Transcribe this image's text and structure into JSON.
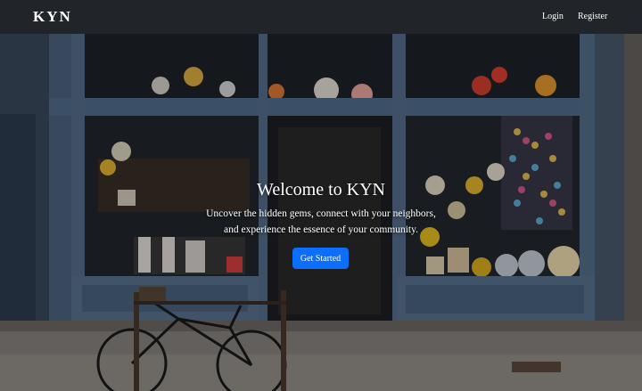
{
  "navbar": {
    "brand": "KYN",
    "links": [
      "Login",
      "Register"
    ]
  },
  "hero": {
    "title": "Welcome to KYN",
    "subtitle_line1": "Uncover the hidden gems, connect with your neighbors,",
    "subtitle_line2": "and experience the essence of your community.",
    "button_label": "Get Started"
  },
  "colors": {
    "navbar_bg": "#212529",
    "button_bg": "#0d6efd"
  }
}
